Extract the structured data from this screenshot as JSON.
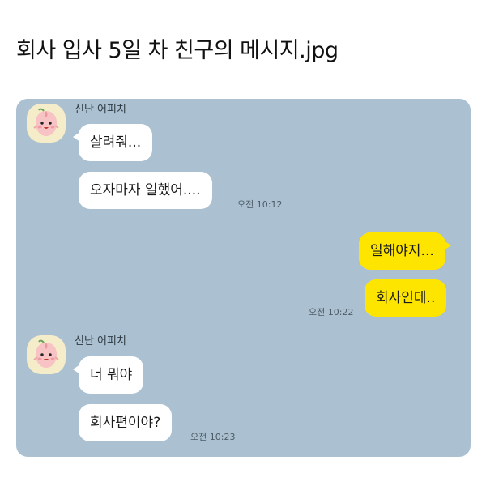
{
  "post": {
    "title": "회사 입사 5일 차 친구의 메시지.jpg"
  },
  "colors": {
    "chat_background": "#abc1d1",
    "incoming_bubble": "#ffffff",
    "outgoing_bubble": "#fee500",
    "avatar_background": "#f5edc9"
  },
  "chat": {
    "groups": [
      {
        "sender": "신난 어피치",
        "avatar_icon": "apeach-avatar-icon",
        "messages": [
          "살려줘...",
          "오자마자 일했어...."
        ],
        "time": "오전 10:12"
      },
      {
        "sender": "me",
        "messages": [
          "일해야지...",
          "회사인데.."
        ],
        "time": "오전 10:22"
      },
      {
        "sender": "신난 어피치",
        "avatar_icon": "apeach-avatar-icon",
        "messages": [
          "너 뭐야",
          "회사편이야?"
        ],
        "time": "오전 10:23"
      }
    ]
  }
}
